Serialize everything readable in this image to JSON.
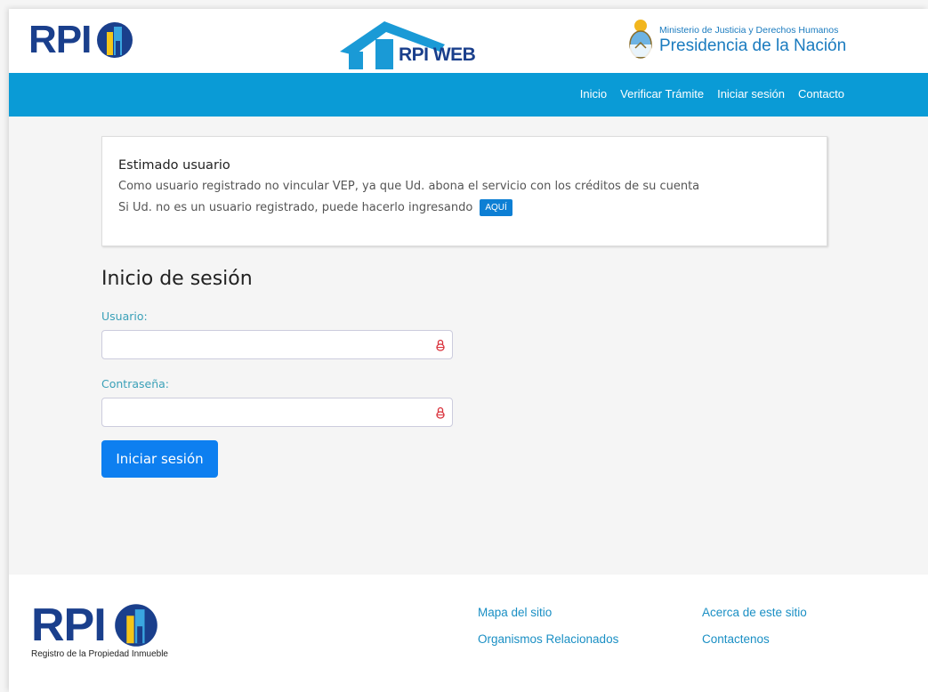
{
  "header": {
    "rpi_logo_text": "RPI",
    "web_logo_text": "RPI WEB",
    "gov_line1": "Ministerio de Justicia y Derechos Humanos",
    "gov_line2": "Presidencia de la Nación"
  },
  "nav": {
    "items": [
      "Inicio",
      "Verificar Trámite",
      "Iniciar sesión",
      "Contacto"
    ]
  },
  "notice": {
    "title": "Estimado usuario",
    "line1": "Como usuario registrado no vincular VEP, ya que Ud. abona el servicio con los créditos de su cuenta",
    "line2": "Si Ud. no es un usuario registrado, puede hacerlo ingresando",
    "button": "AQUÍ"
  },
  "login": {
    "title": "Inicio de sesión",
    "user_label": "Usuario:",
    "password_label": "Contraseña:",
    "user_value": "",
    "password_value": "",
    "submit": "Iniciar sesión"
  },
  "footer": {
    "logo_text": "RPI",
    "logo_subtitle": "Registro de la Propiedad Inmueble",
    "links": [
      "Mapa del sitio",
      "Organismos Relacionados",
      "Acerca de este sitio",
      "Contactenos"
    ]
  },
  "icons": {
    "lock": "lock-icon",
    "brand_mark": "building-icon",
    "roof": "house-roof-icon",
    "seal": "coat-of-arms-icon"
  },
  "colors": {
    "brand_blue": "#1a3f8c",
    "nav_bar": "#0a9bd6",
    "primary_button": "#0d7ff0",
    "label_teal": "#3aa0b8",
    "link": "#1a8fc4"
  }
}
